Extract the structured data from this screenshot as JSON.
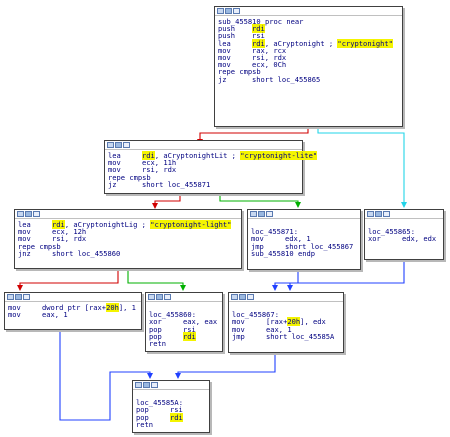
{
  "blocks": [
    {
      "id": "b0",
      "lines": [
        {
          "lbl": "sub_455810 proc near"
        },
        {
          "m": "push",
          "a": [
            {
              "t": "rdi",
              "h": 1
            }
          ]
        },
        {
          "m": "push",
          "a": [
            {
              "t": "rsi"
            }
          ]
        },
        {
          "m": "lea",
          "a": [
            {
              "t": "rdi",
              "h": 1
            },
            {
              "t": ", aCryptonight ; "
            },
            {
              "t": "\"cryptonight\"",
              "h": 1
            }
          ]
        },
        {
          "m": "mov",
          "a": [
            {
              "t": "rax, rcx"
            }
          ]
        },
        {
          "m": "mov",
          "a": [
            {
              "t": "rsi, rdx"
            }
          ]
        },
        {
          "m": "mov",
          "a": [
            {
              "t": "ecx, 0Ch"
            }
          ]
        },
        {
          "m": "repe cmpsb",
          "a": []
        },
        {
          "m": "jz",
          "a": [
            {
              "t": "short loc_455865"
            }
          ]
        }
      ]
    },
    {
      "id": "b1",
      "lines": [
        {
          "m": "lea",
          "a": [
            {
              "t": "rdi",
              "h": 1
            },
            {
              "t": ", aCryptonightLit ; "
            },
            {
              "t": "\"cryptonight-lite\"",
              "h": 1
            }
          ]
        },
        {
          "m": "mov",
          "a": [
            {
              "t": "ecx, 11h"
            }
          ]
        },
        {
          "m": "mov",
          "a": [
            {
              "t": "rsi, rdx"
            }
          ]
        },
        {
          "m": "repe cmpsb",
          "a": []
        },
        {
          "m": "jz",
          "a": [
            {
              "t": "short loc_455871"
            }
          ]
        }
      ]
    },
    {
      "id": "b2",
      "lines": [
        {
          "m": "lea",
          "a": [
            {
              "t": "rdi",
              "h": 1
            },
            {
              "t": ", aCryptonightLig ; "
            },
            {
              "t": "\"cryptonight-light\"",
              "h": 1
            }
          ]
        },
        {
          "m": "mov",
          "a": [
            {
              "t": "ecx, 12h"
            }
          ]
        },
        {
          "m": "mov",
          "a": [
            {
              "t": "rsi, rdx"
            }
          ]
        },
        {
          "m": "repe cmpsb",
          "a": []
        },
        {
          "m": "jnz",
          "a": [
            {
              "t": "short loc_455860"
            }
          ]
        }
      ]
    },
    {
      "id": "b3",
      "lines": [
        {
          "lbl": ""
        },
        {
          "lbl": "loc_455871:"
        },
        {
          "m": "mov",
          "a": [
            {
              "t": "edx, 1"
            }
          ]
        },
        {
          "m": "jmp",
          "a": [
            {
              "t": "short loc_455867"
            }
          ]
        },
        {
          "lbl": "sub_455810 endp"
        }
      ]
    },
    {
      "id": "b4",
      "lines": [
        {
          "lbl": ""
        },
        {
          "lbl": "loc_455865:"
        },
        {
          "m": "xor",
          "a": [
            {
              "t": "edx, edx"
            }
          ]
        }
      ]
    },
    {
      "id": "b5",
      "lines": [
        {
          "m": "mov",
          "a": [
            {
              "t": "dword ptr [rax+"
            },
            {
              "t": "20h",
              "h": 1
            },
            {
              "t": "], 1"
            }
          ]
        },
        {
          "m": "mov",
          "a": [
            {
              "t": "eax, 1"
            }
          ]
        }
      ]
    },
    {
      "id": "b6",
      "lines": [
        {
          "lbl": ""
        },
        {
          "lbl": "loc_455860:"
        },
        {
          "m": "xor",
          "a": [
            {
              "t": "eax, eax"
            }
          ]
        },
        {
          "m": "pop",
          "a": [
            {
              "t": "rsi"
            }
          ]
        },
        {
          "m": "pop",
          "a": [
            {
              "t": "rdi",
              "h": 1
            }
          ]
        },
        {
          "m": "retn",
          "a": []
        }
      ]
    },
    {
      "id": "b7",
      "lines": [
        {
          "lbl": ""
        },
        {
          "lbl": "loc_455867:"
        },
        {
          "m": "mov",
          "a": [
            {
              "t": "[rax+"
            },
            {
              "t": "20h",
              "h": 1
            },
            {
              "t": "], edx"
            }
          ]
        },
        {
          "m": "mov",
          "a": [
            {
              "t": "eax, 1"
            }
          ]
        },
        {
          "m": "jmp",
          "a": [
            {
              "t": "short loc_45585A"
            }
          ]
        }
      ]
    },
    {
      "id": "b8",
      "lines": [
        {
          "lbl": ""
        },
        {
          "lbl": "loc_45585A:"
        },
        {
          "m": "pop",
          "a": [
            {
              "t": "rsi"
            }
          ]
        },
        {
          "m": "pop",
          "a": [
            {
              "t": "rdi",
              "h": 1
            }
          ]
        },
        {
          "m": "retn",
          "a": []
        }
      ]
    }
  ],
  "edge_colors": {
    "true": "#00b000",
    "false": "#d00000",
    "jump": "#2040ff",
    "cond": "#22d4e8"
  }
}
